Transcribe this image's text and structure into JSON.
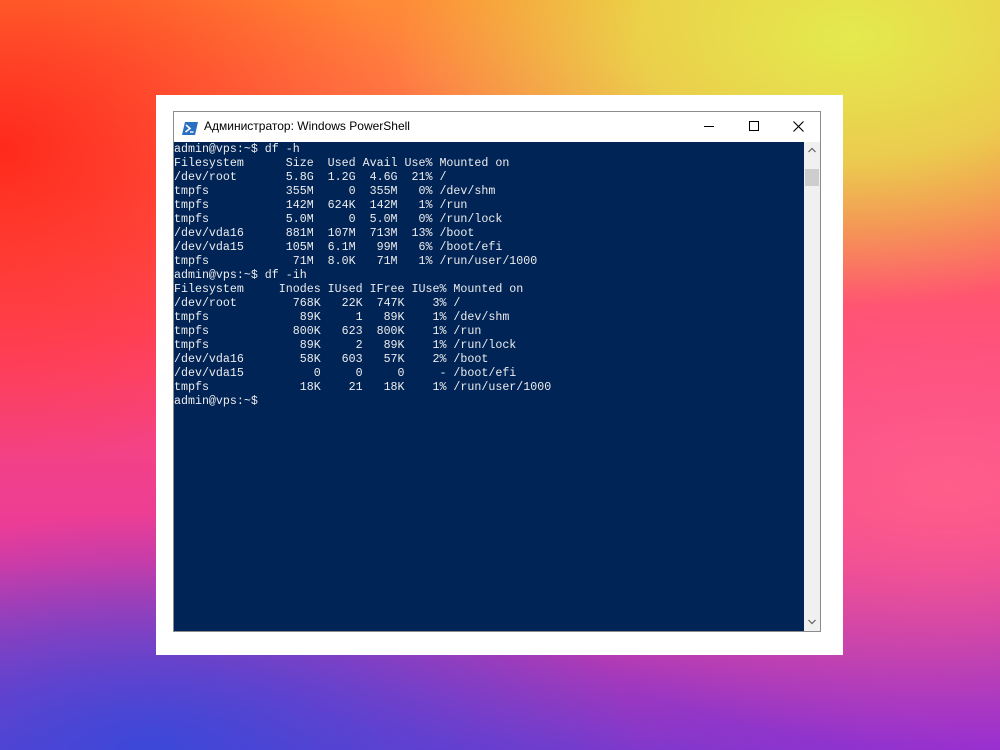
{
  "window": {
    "title": "Администратор: Windows PowerShell",
    "app_icon": "powershell-icon",
    "controls": {
      "minimize_icon": "minimize-icon",
      "maximize_icon": "maximize-icon",
      "close_icon": "close-icon"
    }
  },
  "colors": {
    "console_background": "#012456",
    "console_text": "#ececec"
  },
  "terminal": {
    "lines": [
      "admin@vps:~$ df -h",
      "Filesystem      Size  Used Avail Use% Mounted on",
      "/dev/root       5.8G  1.2G  4.6G  21% /",
      "tmpfs           355M     0  355M   0% /dev/shm",
      "tmpfs           142M  624K  142M   1% /run",
      "tmpfs           5.0M     0  5.0M   0% /run/lock",
      "/dev/vda16      881M  107M  713M  13% /boot",
      "/dev/vda15      105M  6.1M   99M   6% /boot/efi",
      "tmpfs            71M  8.0K   71M   1% /run/user/1000",
      "admin@vps:~$ df -ih",
      "Filesystem     Inodes IUsed IFree IUse% Mounted on",
      "/dev/root        768K   22K  747K    3% /",
      "tmpfs             89K     1   89K    1% /dev/shm",
      "tmpfs            800K   623  800K    1% /run",
      "tmpfs             89K     2   89K    1% /run/lock",
      "/dev/vda16        58K   603   57K    2% /boot",
      "/dev/vda15          0     0     0     - /boot/efi",
      "tmpfs             18K    21   18K    1% /run/user/1000",
      "admin@vps:~$"
    ]
  },
  "scrollbar": {
    "up_icon": "chevron-up-icon",
    "down_icon": "chevron-down-icon"
  }
}
